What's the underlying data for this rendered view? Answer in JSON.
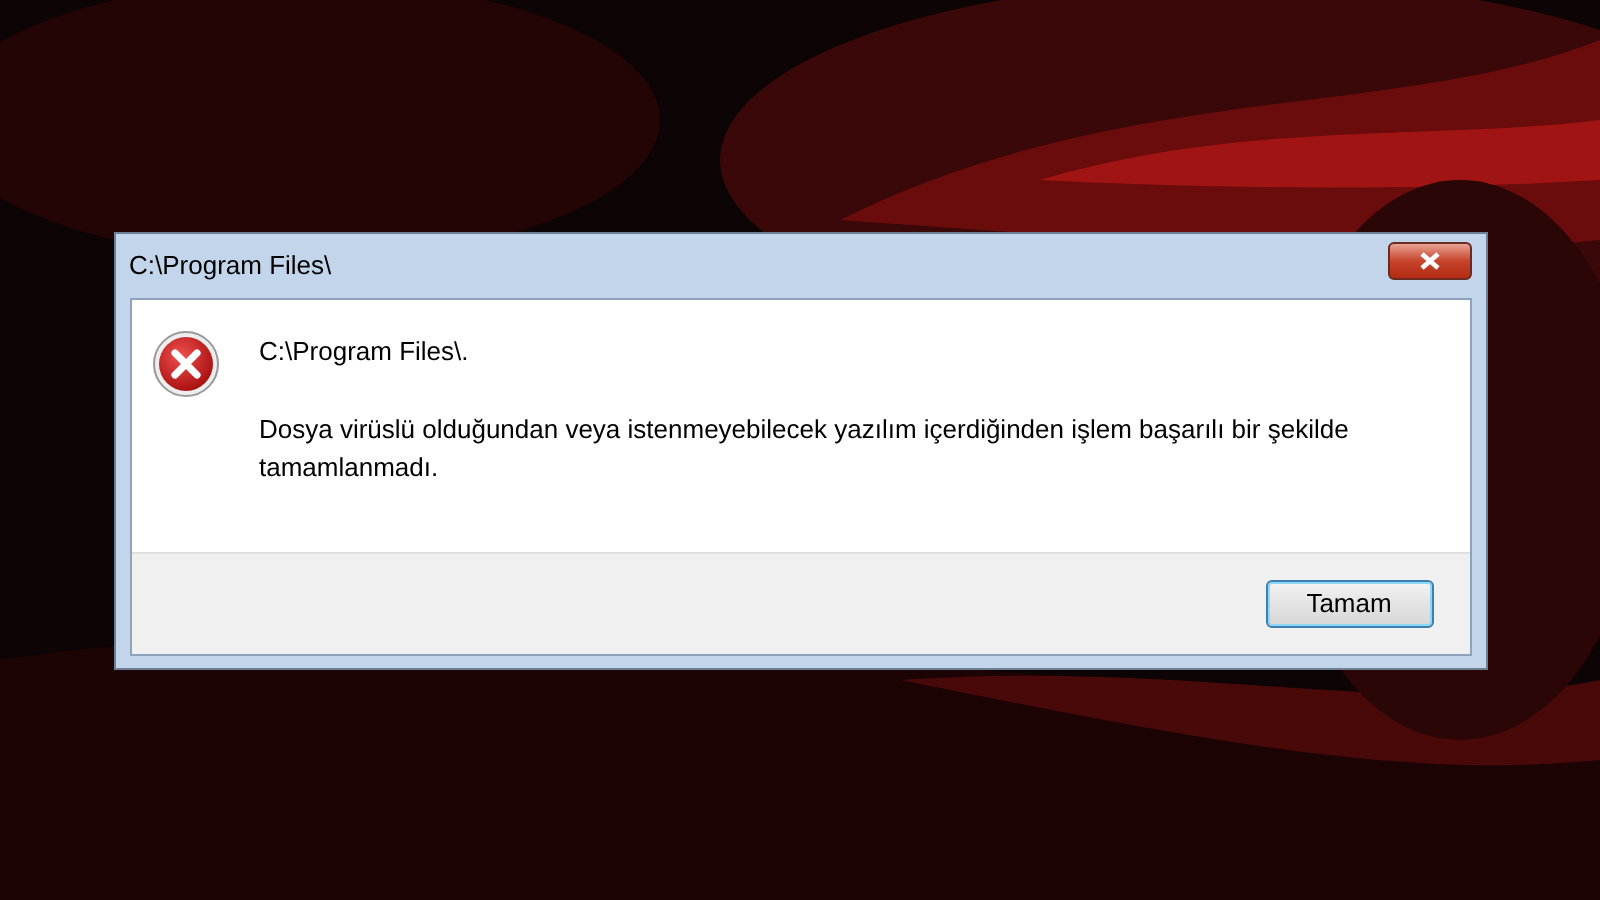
{
  "window": {
    "title": "C:\\Program Files\\"
  },
  "dialog": {
    "heading": "C:\\Program Files\\.",
    "message": "Dosya virüslü olduğundan veya istenmeyebilecek yazılım içerdiğinden işlem başarılı bir şekilde tamamlanmadı.",
    "buttons": [
      "Tamam"
    ]
  }
}
